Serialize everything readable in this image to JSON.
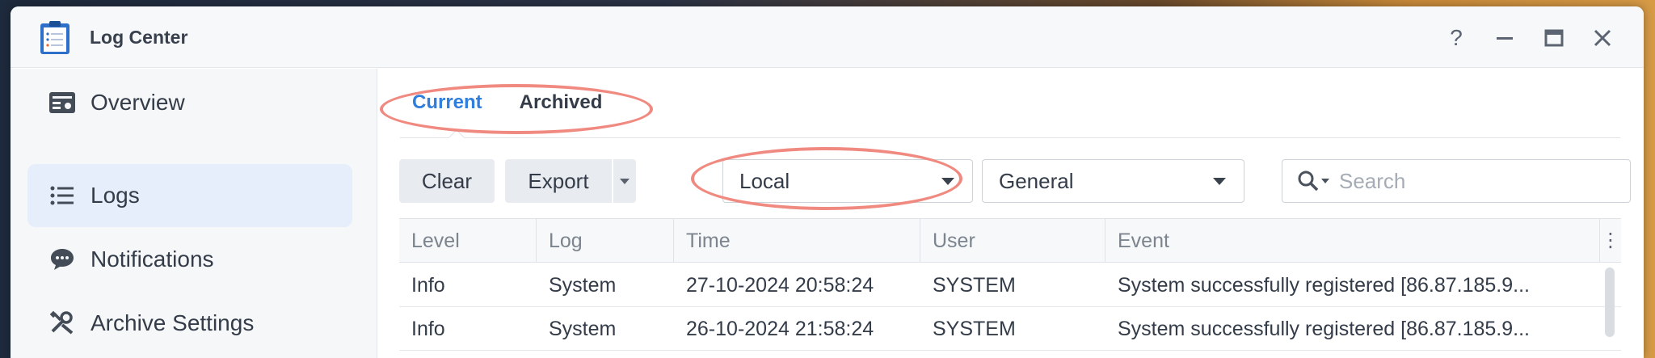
{
  "window": {
    "title": "Log Center",
    "controls": [
      "help-icon",
      "minimize-icon",
      "maximize-icon",
      "close-icon"
    ]
  },
  "sidebar": {
    "items": [
      {
        "label": "Overview",
        "icon": "overview-icon",
        "active": false
      },
      {
        "label": "Logs",
        "icon": "list-icon",
        "active": true
      },
      {
        "label": "Notifications",
        "icon": "chat-bubble-icon",
        "active": false
      },
      {
        "label": "Archive Settings",
        "icon": "tools-icon",
        "active": false
      }
    ]
  },
  "tabs": [
    {
      "label": "Current",
      "active": true
    },
    {
      "label": "Archived",
      "active": false
    }
  ],
  "toolbar": {
    "clear_label": "Clear",
    "export_label": "Export",
    "source_value": "Local",
    "type_value": "General",
    "search_placeholder": "Search"
  },
  "table": {
    "columns": [
      "Level",
      "Log",
      "Time",
      "User",
      "Event"
    ],
    "rows": [
      {
        "level": "Info",
        "log": "System",
        "time": "27-10-2024 20:58:24",
        "user": "SYSTEM",
        "event": "System successfully registered [86.87.185.9..."
      },
      {
        "level": "Info",
        "log": "System",
        "time": "26-10-2024 21:58:24",
        "user": "SYSTEM",
        "event": "System successfully registered [86.87.185.9..."
      }
    ]
  },
  "colors": {
    "accent": "#2f7ddc",
    "active_nav_bg": "#e6eefb",
    "annotation": "#f08a80"
  }
}
